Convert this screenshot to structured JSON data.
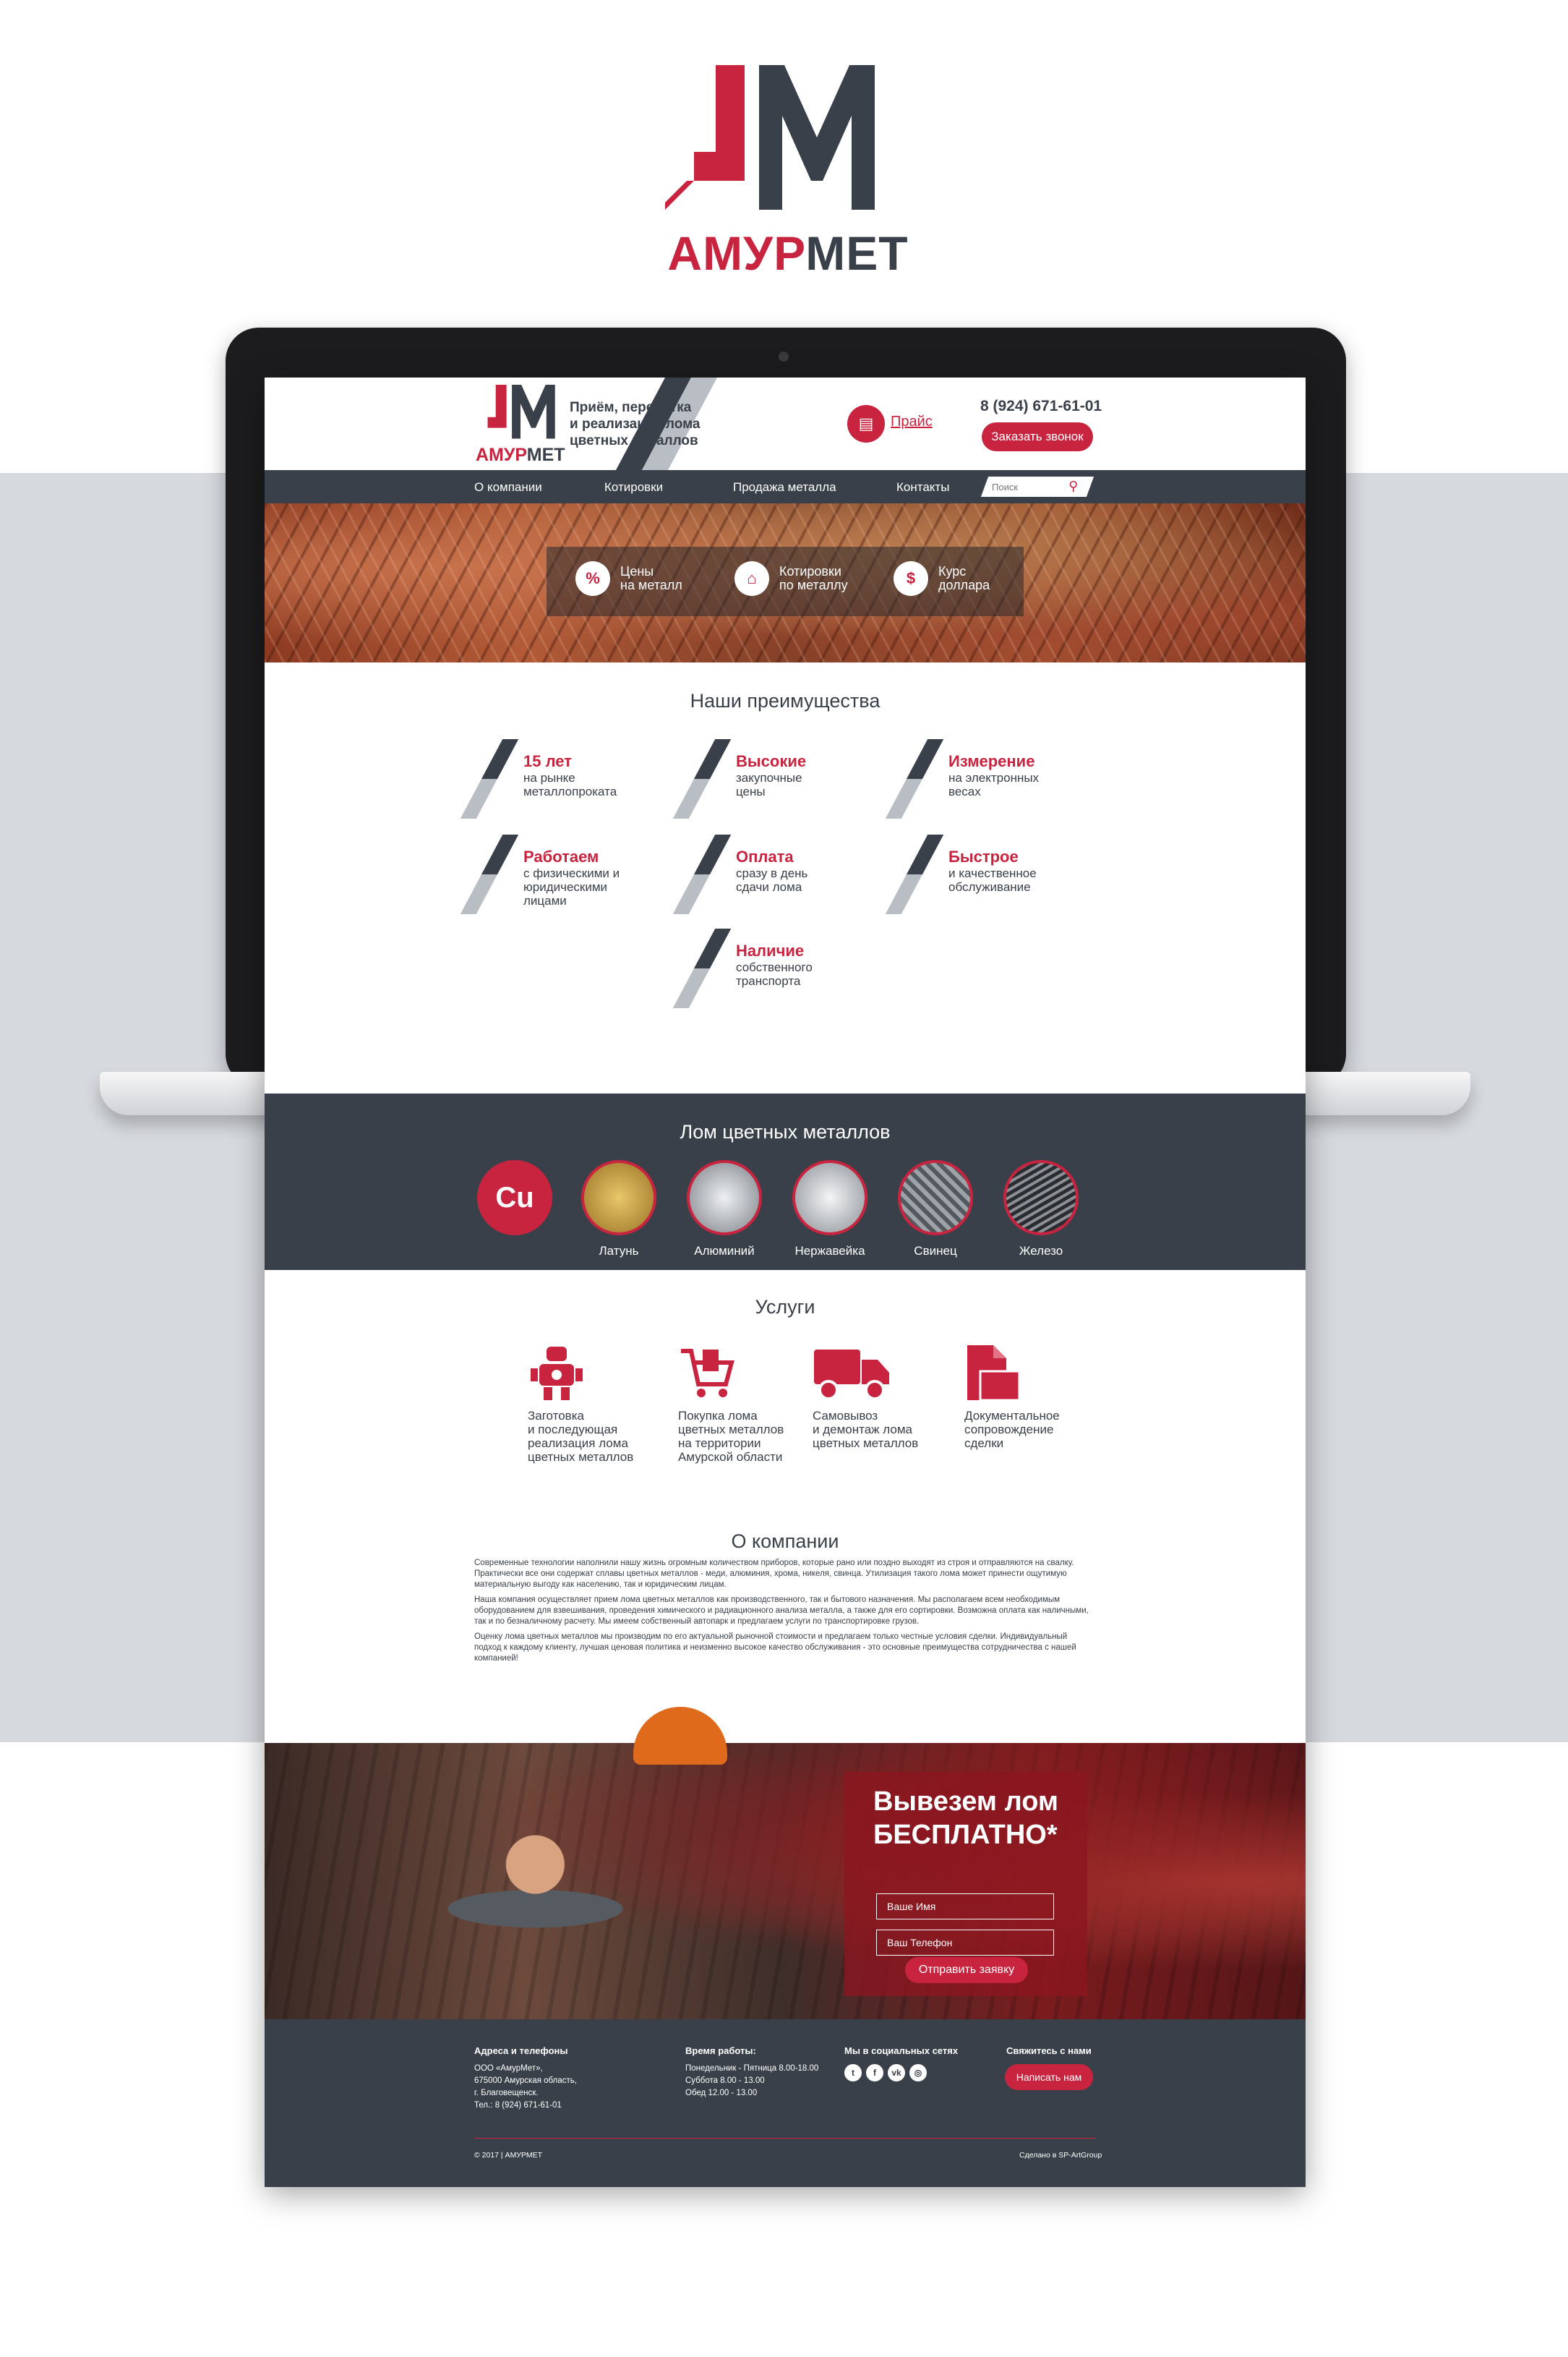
{
  "brand": {
    "part1": "АМУР",
    "part2": "МЕТ"
  },
  "header": {
    "tagline": "Приём, переботка\nи реализация лома\nцветных металлов",
    "price_label": "Прайс",
    "phone": "8 (924) 671-61-01",
    "call_button": "Заказать звонок"
  },
  "nav": {
    "items": [
      "О компании",
      "Котировки",
      "Продажа металла",
      "Контакты"
    ],
    "search_placeholder": "Поиск"
  },
  "hero": {
    "items": [
      {
        "icon": "price-tag-icon",
        "label": "Цены\nна металл"
      },
      {
        "icon": "house-chart-icon",
        "label": "Котировки\nпо металлу"
      },
      {
        "icon": "dollar-icon",
        "label": "Курс\nдоллара"
      }
    ]
  },
  "advantages": {
    "title": "Наши преимущества",
    "items": [
      {
        "title": "15 лет",
        "desc": "на рынке\nметаллопроката"
      },
      {
        "title": "Высокие",
        "desc": "закупочные\nцены"
      },
      {
        "title": "Измерение",
        "desc": "на электронных\nвесах"
      },
      {
        "title": "Работаем",
        "desc": "с физическими и\nюридическими\nлицами"
      },
      {
        "title": "Оплата",
        "desc": "сразу в день\nсдачи лома"
      },
      {
        "title": "Быстрое",
        "desc": "и качественное\nобслуживание"
      },
      {
        "title": "Наличие",
        "desc": "собственного\nтранспорта"
      }
    ]
  },
  "metals": {
    "title": "Лом цветных металлов",
    "cu_symbol": "Cu",
    "items": [
      "Латунь",
      "Алюминий",
      "Нержавейка",
      "Свинец",
      "Железо"
    ]
  },
  "services": {
    "title": "Услуги",
    "items": [
      {
        "icon": "robot-icon",
        "text": "Заготовка\nи последующая\nреализация лома\nцветных металлов"
      },
      {
        "icon": "cart-icon",
        "text": "Покупка лома\nцветных металлов\nна территории\nАмурской области"
      },
      {
        "icon": "truck-icon",
        "text": "Самовывоз\nи демонтаж лома\nцветных металлов"
      },
      {
        "icon": "document-icon",
        "text": "Документальное\nсопровождение\nсделки"
      }
    ]
  },
  "about": {
    "title": "О компании",
    "paragraphs": [
      "Современные технологии наполнили нашу жизнь огромным количеством приборов, которые рано или поздно выходят из строя и отправляются на свалку. Практически все они содержат сплавы цветных металлов - меди, алюминия, хрома, никеля, свинца. Утилизация такого лома может принести ощутимую материальную выгоду как населению, так и юридическим лицам.",
      "Наша компания осуществляет прием лома цветных металлов как производственного, так и бытового назначения. Мы располагаем всем необходимым оборудованием для взвешивания, проведения химического и радиационного анализа металла, а также для его сортировки. Возможна оплата как наличными, так и по безналичному расчету. Мы имеем собственный автопарк и предлагаем услуги по транспортировке грузов.",
      "Оценку лома цветных металлов мы производим по его актуальной рыночной стоимости и предлагаем только честные условия сделки. Индивидуальный подход к каждому клиенту, лучшая ценовая политика и неизменно высокое качество обслуживания - это основные преимущества сотрудничества с нашей компанией!"
    ]
  },
  "promo": {
    "title": "Вывезем лом\nБЕСПЛАТНО*",
    "name_placeholder": "Ваше Имя",
    "phone_placeholder": "Ваш Телефон",
    "submit": "Отправить заявку"
  },
  "footer": {
    "addr_title": "Адреса и телефоны",
    "addr_text": "ООО «АмурМет»,\n675000 Амурская область,\nг. Благовещенск.\nТел.: 8 (924) 671-61-01",
    "hours_title": "Время работы:",
    "hours_text": "Понедельник - Пятница 8.00-18.00\nСуббота 8.00 - 13.00\nОбед 12.00 - 13.00",
    "social_title": "Мы в социальных сетях",
    "social_icons": [
      "twitter-icon",
      "facebook-icon",
      "vk-icon",
      "instagram-icon"
    ],
    "contact_title": "Свяжитесь с нами",
    "contact_button": "Написать нам",
    "copyright": "© 2017 | АМУРМЕТ",
    "made_by": "Сделано в SP-ArtGroup"
  },
  "colors": {
    "accent": "#c8243f",
    "dark": "#3a4049",
    "band": "#d6d9de"
  }
}
